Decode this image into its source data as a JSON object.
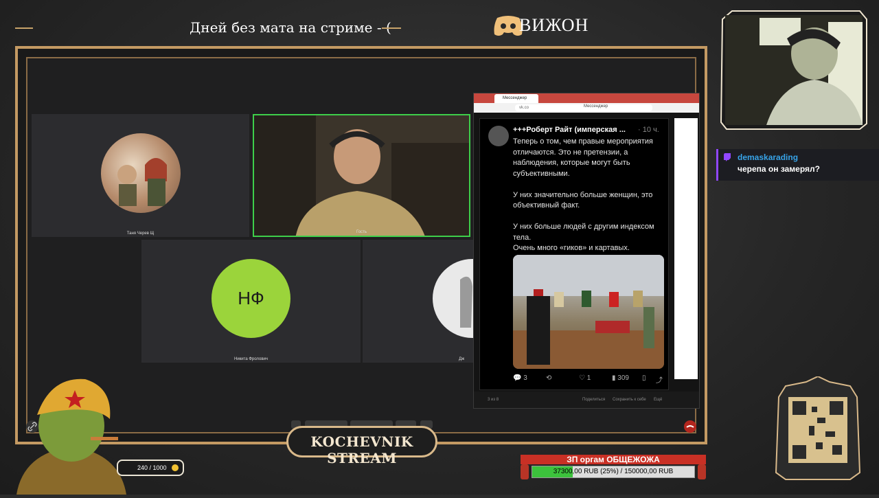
{
  "overlay": {
    "ticker_text": "Дней без мата на стриме - (",
    "discord_label": "ВИЖОН",
    "brand": "KOCHEVNIK STREAM",
    "points": "240 / 1000"
  },
  "call": {
    "participants": [
      {
        "name": "Таня Черев Щ"
      },
      {
        "name": "Гость"
      },
      {
        "name": "Никита Фролович",
        "initials": "НФ"
      },
      {
        "name": "Дж"
      }
    ]
  },
  "browser": {
    "tab_title": "Мессенджер",
    "url": "vk.co",
    "page_title": "Мессенджер",
    "tweet": {
      "author": "+++Роберт Райт (имперская ...",
      "time": "· 10 ч.",
      "text": "Теперь о том, чем правые мероприятия отличаются. Это не претензии, а наблюдения, которые могут быть субъективными.\n\nУ них значительно больше женщин, это объективный факт.\n\nУ них больше людей с другим индексом тела.\nОчень много «гиков» и картавых.",
      "replies": "3",
      "likes": "1",
      "views": "309"
    },
    "footer": {
      "counter": "3 из 8",
      "share": "Поделиться",
      "save": "Сохранить к себе",
      "more": "Ещё"
    }
  },
  "chat": {
    "user": "demaskarading",
    "message": "черепа он замерял?"
  },
  "goal": {
    "title": "ЗП оргам ОБЩЕЖОЖА",
    "progress_text": "37300,00 RUB (25%) / 150000,00 RUB",
    "progress_fraction": 0.25
  },
  "colors": {
    "frame_gold": "#c49a63",
    "speaking_border": "#3ecf4a",
    "nf_avatar": "#9bd43b",
    "goal_red": "#c93025",
    "goal_green": "#3cc23c",
    "twitch_purple": "#9147ff",
    "chat_username": "#37a3e8"
  }
}
